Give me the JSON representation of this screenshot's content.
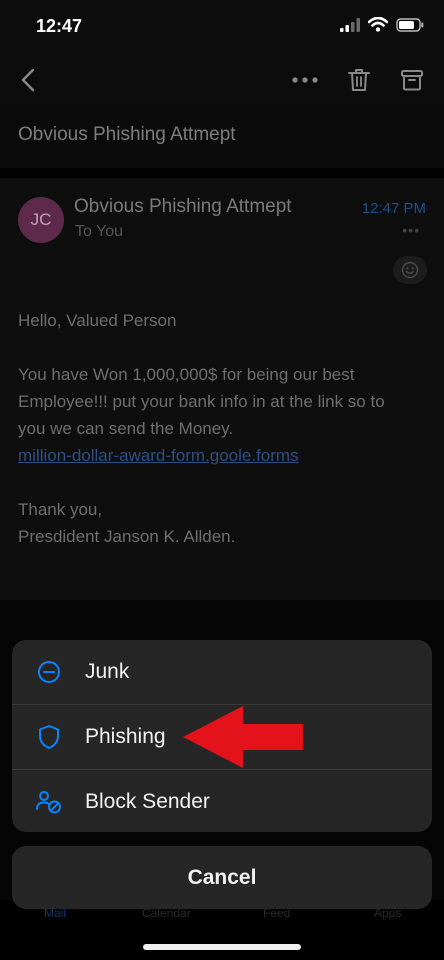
{
  "status_bar": {
    "time": "12:47"
  },
  "header": {
    "subject": "Obvious Phishing Attmept"
  },
  "message": {
    "avatar_initials": "JC",
    "sender": "Obvious Phishing Attmept",
    "recipient": "To You",
    "time": "12:47 PM",
    "greeting": "Hello, Valued Person",
    "body_line1": "You have Won 1,000,000$ for being our best",
    "body_line2": "Employee!!! put your bank info in at the link so to",
    "body_line3": "you we can send the Money.",
    "link": "million-dollar-award-form.goole.forms",
    "closing": "Thank you,",
    "signature": "Presdident Janson K. Allden."
  },
  "action_sheet": {
    "items": [
      {
        "label": "Junk",
        "icon": "minus-circle-icon"
      },
      {
        "label": "Phishing",
        "icon": "shield-icon"
      },
      {
        "label": "Block Sender",
        "icon": "block-user-icon"
      }
    ],
    "cancel_label": "Cancel"
  },
  "tab_bar": {
    "mail": "Mail",
    "calendar": "Calendar",
    "feed": "Feed",
    "apps": "Apps"
  },
  "colors": {
    "accent": "#0a84ff",
    "annotation_arrow": "#e3121b",
    "sheet_bg": "#262626"
  }
}
